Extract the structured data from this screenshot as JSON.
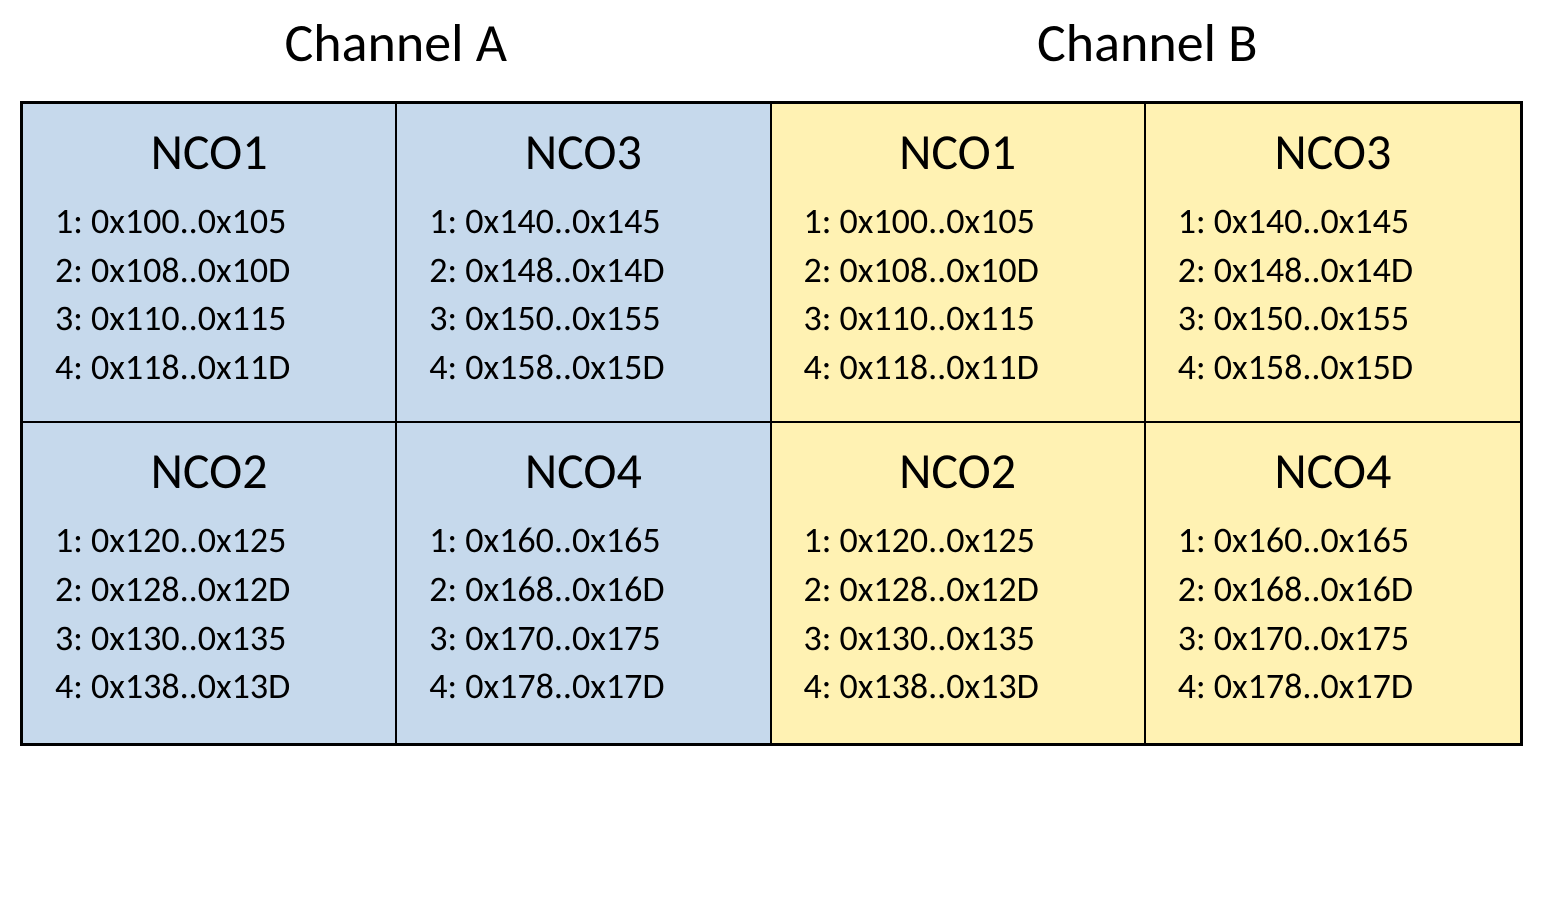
{
  "headers": {
    "channel_a": "Channel A",
    "channel_b": "Channel B"
  },
  "cells": [
    {
      "channel": "a",
      "title": "NCO1",
      "entries": [
        "1: 0x100..0x105",
        "2: 0x108..0x10D",
        "3: 0x110..0x115",
        "4: 0x118..0x11D"
      ]
    },
    {
      "channel": "a",
      "title": "NCO3",
      "entries": [
        "1: 0x140..0x145",
        "2: 0x148..0x14D",
        "3: 0x150..0x155",
        "4: 0x158..0x15D"
      ]
    },
    {
      "channel": "b",
      "title": "NCO1",
      "entries": [
        "1: 0x100..0x105",
        "2: 0x108..0x10D",
        "3: 0x110..0x115",
        "4: 0x118..0x11D"
      ]
    },
    {
      "channel": "b",
      "title": "NCO3",
      "entries": [
        "1: 0x140..0x145",
        "2: 0x148..0x14D",
        "3: 0x150..0x155",
        "4: 0x158..0x15D"
      ]
    },
    {
      "channel": "a",
      "title": "NCO2",
      "entries": [
        "1: 0x120..0x125",
        "2: 0x128..0x12D",
        "3: 0x130..0x135",
        "4: 0x138..0x13D"
      ]
    },
    {
      "channel": "a",
      "title": "NCO4",
      "entries": [
        "1: 0x160..0x165",
        "2: 0x168..0x16D",
        "3: 0x170..0x175",
        "4: 0x178..0x17D"
      ]
    },
    {
      "channel": "b",
      "title": "NCO2",
      "entries": [
        "1: 0x120..0x125",
        "2: 0x128..0x12D",
        "3: 0x130..0x135",
        "4: 0x138..0x13D"
      ]
    },
    {
      "channel": "b",
      "title": "NCO4",
      "entries": [
        "1: 0x160..0x165",
        "2: 0x168..0x16D",
        "3: 0x170..0x175",
        "4: 0x178..0x17D"
      ]
    }
  ],
  "colors": {
    "channel_a_bg": "#c6d9ec",
    "channel_b_bg": "#fff2b3"
  }
}
